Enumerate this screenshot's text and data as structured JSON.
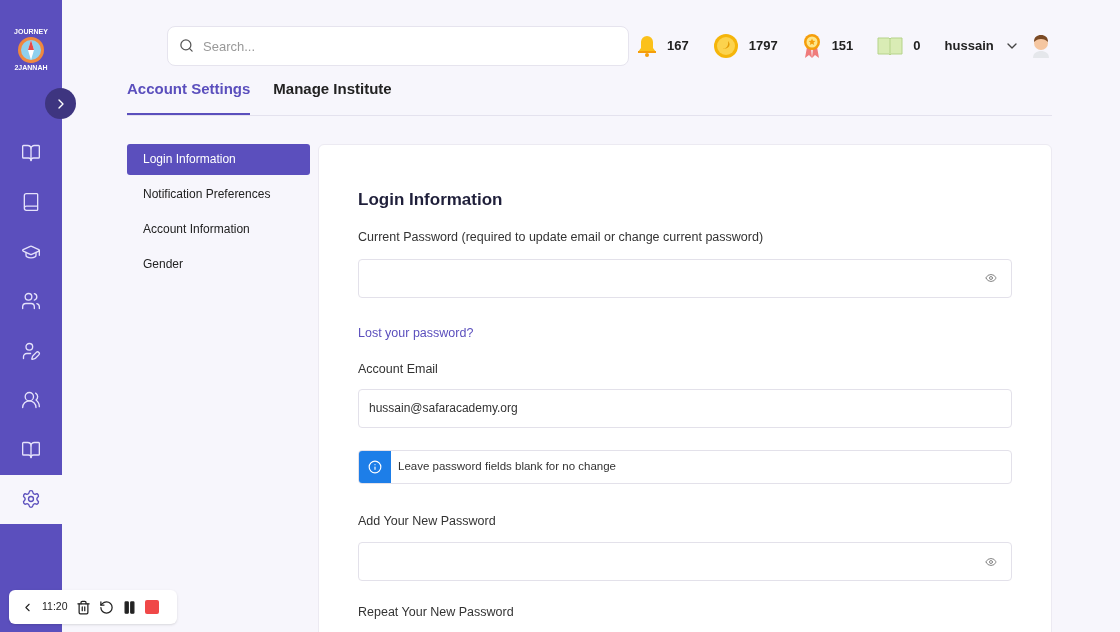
{
  "logo": {
    "top": "JOURNEY",
    "bottom": "2JANNAH"
  },
  "sidebar": {
    "items": [
      {
        "kind": "reading",
        "selected": false
      },
      {
        "kind": "library",
        "selected": false
      },
      {
        "kind": "courses",
        "selected": false
      },
      {
        "kind": "people",
        "selected": false
      },
      {
        "kind": "teachers",
        "selected": false
      },
      {
        "kind": "groups",
        "selected": false
      },
      {
        "kind": "reading",
        "selected": false
      },
      {
        "kind": "settings",
        "selected": true
      }
    ]
  },
  "search": {
    "placeholder": "Search..."
  },
  "stats": [
    {
      "kind": "bell",
      "value": "167"
    },
    {
      "kind": "coin",
      "value": "1797"
    },
    {
      "kind": "medal",
      "value": "151"
    },
    {
      "kind": "book",
      "value": "0"
    }
  ],
  "user": {
    "name": "hussain"
  },
  "tabs": [
    {
      "label": "Account Settings",
      "selected": true
    },
    {
      "label": "Manage Institute",
      "selected": false
    }
  ],
  "menu": [
    {
      "label": "Login Information",
      "selected": true
    },
    {
      "label": "Notification Preferences",
      "selected": false
    },
    {
      "label": "Account Information",
      "selected": false
    },
    {
      "label": "Gender",
      "selected": false
    }
  ],
  "form": {
    "title": "Login Information",
    "rows": [
      {
        "kind": "password",
        "label": "Current Password (required to update email or change current password)"
      },
      {
        "kind": "link",
        "label": "Lost your password?"
      },
      {
        "kind": "text",
        "label": "Account Email",
        "value": "hussain@safaracademy.org"
      },
      {
        "kind": "info",
        "label": "Leave password fields blank for no change"
      },
      {
        "kind": "password",
        "label": "Add Your New Password"
      },
      {
        "kind": "password",
        "label": "Repeat Your New Password"
      }
    ]
  },
  "recorder": {
    "time": "11:20"
  }
}
